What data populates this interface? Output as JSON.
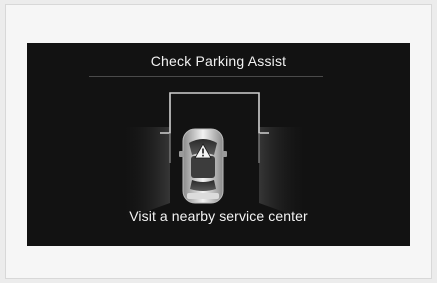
{
  "screen": {
    "title": "Check Parking Assist",
    "message": "Visit a nearby service center"
  },
  "icons": {
    "vehicle": "car-top-view-icon",
    "warning": "warning-triangle-icon",
    "sensor_zones": "parking-sensor-zones-icon"
  },
  "colors": {
    "screen_background": "#121212",
    "text": "#f2f2f2",
    "sensor_outline": "#d0d0d0"
  }
}
